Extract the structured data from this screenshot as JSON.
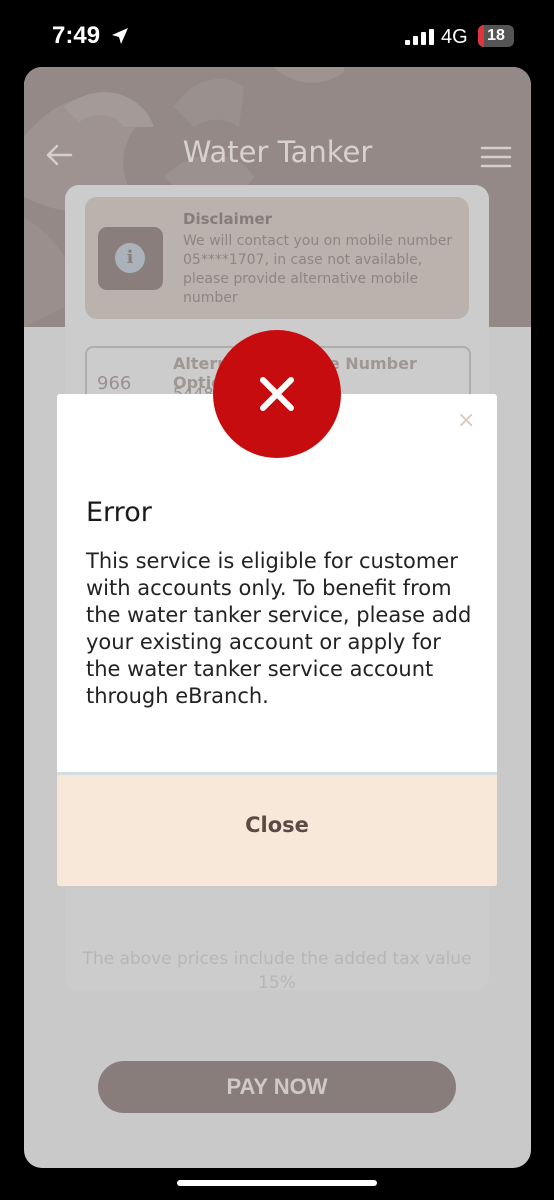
{
  "status_bar": {
    "time": "7:49",
    "network": "4G",
    "battery": "18",
    "battery_percent": 18,
    "battery_color": "#e0343a"
  },
  "header": {
    "title": "Water Tanker",
    "back_icon": "arrow-left-icon",
    "menu_icon": "hamburger-menu-icon",
    "background_color": "#9d8f8b"
  },
  "disclaimer": {
    "icon": "info-icon",
    "title": "Disclaimer",
    "text": "We will contact you on mobile number 05****1707, in case not available, please provide alternative mobile number"
  },
  "alternative_number": {
    "country_code": "966",
    "label": "Alternative Mobile Number Optional",
    "value": "5448"
  },
  "tax_note": "The above prices include the added tax value 15%",
  "pay_button": "PAY NOW",
  "modal": {
    "badge_icon": "error-x-icon",
    "badge_color": "#c60c0f",
    "close_icon": "close-icon",
    "close_symbol": "×",
    "title": "Error",
    "message": "This service is eligible for customer with accounts only. To benefit from the water tanker service, please add your existing account or apply for the water tanker service account through eBranch.",
    "close_button": "Close",
    "footer_color": "#f7e8da"
  }
}
